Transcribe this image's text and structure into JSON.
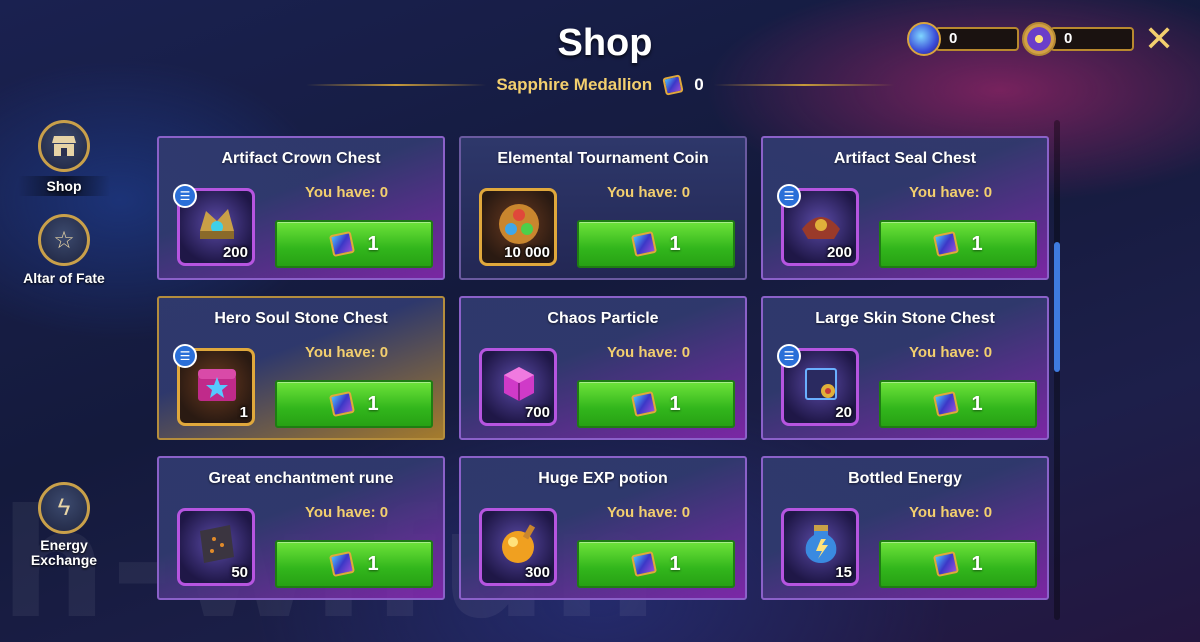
{
  "header": {
    "title": "Shop",
    "currency_name": "Sapphire Medallion",
    "currency_count": "0"
  },
  "top_resources": [
    {
      "icon": "energy-gem-icon",
      "value": "0"
    },
    {
      "icon": "emblem-icon",
      "value": "0"
    }
  ],
  "sidebar": {
    "items": [
      {
        "label": "Shop",
        "icon": "shop-icon",
        "active": true
      },
      {
        "label": "Altar of Fate",
        "icon": "star-icon",
        "active": false
      },
      {
        "label": "Energy Exchange",
        "icon": "lightning-icon",
        "active": false
      }
    ]
  },
  "watermark": "h-w.fun",
  "shop_items": [
    {
      "name": "Artifact Crown Chest",
      "you_have": "You have: 0",
      "quantity": "200",
      "price": "1",
      "rarity": "epic",
      "has_info": true
    },
    {
      "name": "Elemental Tournament Coin",
      "you_have": "You have: 0",
      "quantity": "10 000",
      "price": "1",
      "rarity": "normal",
      "has_info": false
    },
    {
      "name": "Artifact Seal Chest",
      "you_have": "You have: 0",
      "quantity": "200",
      "price": "1",
      "rarity": "epic",
      "has_info": true
    },
    {
      "name": "Hero Soul Stone Chest",
      "you_have": "You have: 0",
      "quantity": "1",
      "price": "1",
      "rarity": "legend",
      "has_info": true
    },
    {
      "name": "Chaos Particle",
      "you_have": "You have: 0",
      "quantity": "700",
      "price": "1",
      "rarity": "epic",
      "has_info": false
    },
    {
      "name": "Large Skin Stone Chest",
      "you_have": "You have: 0",
      "quantity": "20",
      "price": "1",
      "rarity": "epic",
      "has_info": true
    },
    {
      "name": "Great enchantment rune",
      "you_have": "You have: 0",
      "quantity": "50",
      "price": "1",
      "rarity": "epic",
      "has_info": false
    },
    {
      "name": "Huge EXP potion",
      "you_have": "You have: 0",
      "quantity": "300",
      "price": "1",
      "rarity": "epic",
      "has_info": false
    },
    {
      "name": "Bottled Energy",
      "you_have": "You have: 0",
      "quantity": "15",
      "price": "1",
      "rarity": "epic",
      "has_info": false
    }
  ],
  "colors": {
    "gold_text": "#f3cf6e",
    "buy_button": "#32b61c",
    "epic_frame": "#b655e0",
    "legend_frame": "#e0a83c"
  }
}
